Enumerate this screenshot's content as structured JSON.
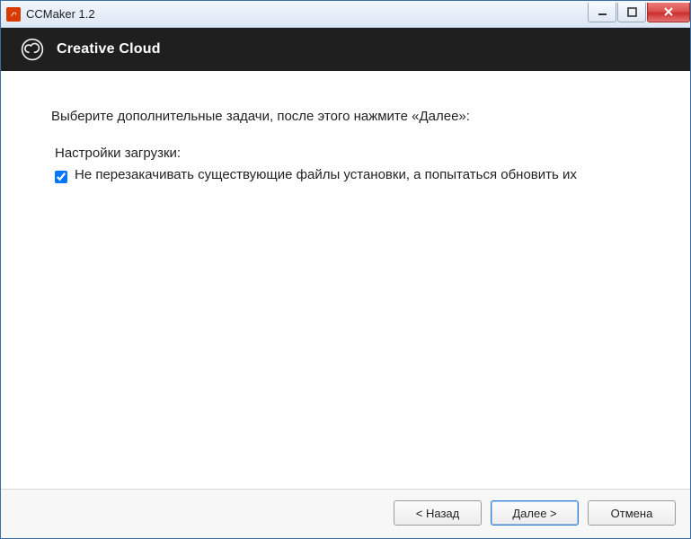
{
  "titlebar": {
    "title": "CCMaker 1.2"
  },
  "header": {
    "title": "Creative Cloud"
  },
  "main": {
    "instruction": "Выберите дополнительные задачи, после этого нажмите «Далее»:",
    "section_label": "Настройки загрузки:",
    "checkbox1": {
      "label": "Не перезакачивать существующие файлы установки, а попытаться обновить их",
      "checked": true
    }
  },
  "footer": {
    "back": "< Назад",
    "next": "Далее >",
    "cancel": "Отмена"
  }
}
